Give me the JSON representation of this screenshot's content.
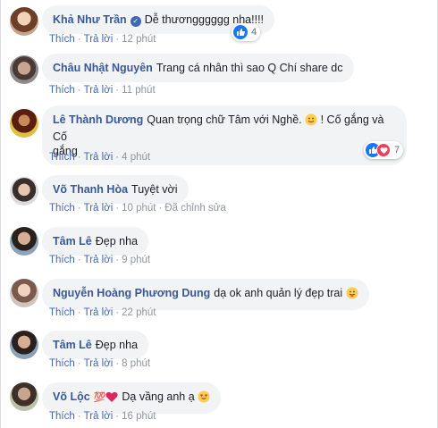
{
  "actions": {
    "like": "Thích",
    "reply": "Trả lời",
    "sep": "·"
  },
  "comments": [
    {
      "author": "Khả Như Trần",
      "verified": true,
      "text": "Dễ thươngggggg nha!!!!",
      "time": "12 phút",
      "reactions": "4"
    },
    {
      "author": "Châu Nhật Nguyên",
      "text": "Trang cá nhân thì sao Q Chí share dc",
      "time": "11 phút"
    },
    {
      "author": "Lê Thành Dương",
      "text_line1": "Quan trọng chữ Tâm với Nghề.",
      "text_line1b": "! Cố gắng và Cố",
      "text_line2": "gắng",
      "time": "4 phút",
      "reactions": "7"
    },
    {
      "author": "Võ Thanh Hòa",
      "text": "Tuyệt vời",
      "time": "10 phút",
      "edited": "Đã chỉnh sửa"
    },
    {
      "author": "Tâm Lê",
      "text": "Đẹp nha",
      "time": "9 phút"
    },
    {
      "author": "Nguyễn Hoàng Phương Dung",
      "text": "dạ ok anh quản lý đẹp trai",
      "time": "22 phút"
    },
    {
      "author": "Tâm Lê",
      "text": "Đẹp nha",
      "time": "8 phút"
    },
    {
      "author": "Võ Lộc",
      "badge": "💯",
      "text": "Dạ vầng anh ạ",
      "time": "16 phút"
    }
  ]
}
